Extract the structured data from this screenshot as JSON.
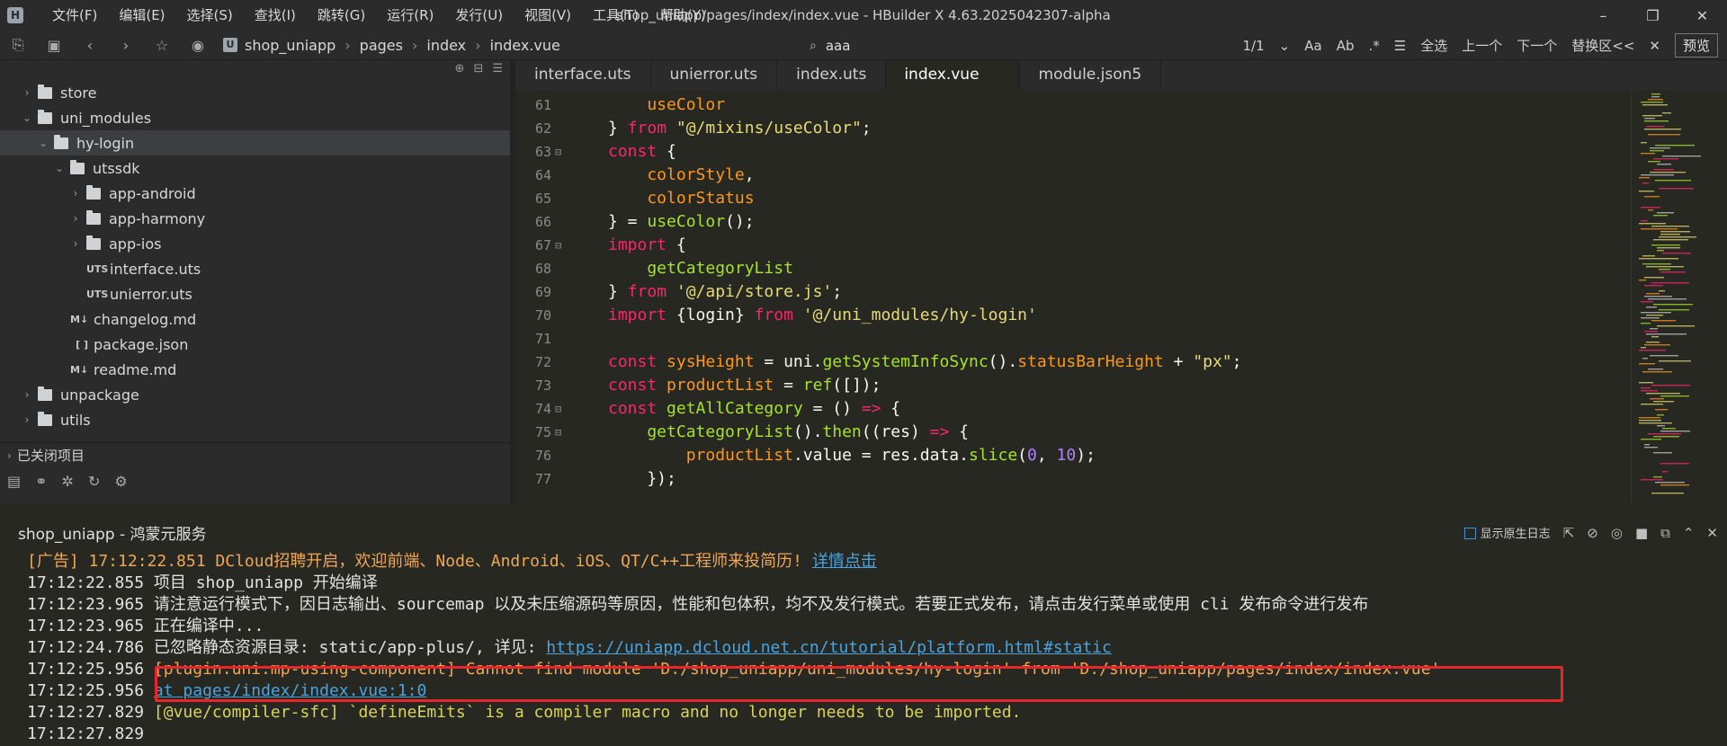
{
  "app": {
    "title": "shop_uniapp/pages/index/index.vue - HBuilder X 4.63.2025042307-alpha",
    "logo_letter": "H"
  },
  "menu": [
    "文件(F)",
    "编辑(E)",
    "选择(S)",
    "查找(I)",
    "跳转(G)",
    "运行(R)",
    "发行(U)",
    "视图(V)",
    "工具(T)",
    "帮助(Y)"
  ],
  "window_controls": {
    "minimize": "–",
    "restore": "❐",
    "close": "✕"
  },
  "toolbar": {
    "breadcrumb_icon": "U",
    "breadcrumb": [
      "shop_uniapp",
      "pages",
      "index",
      "index.vue"
    ],
    "search_value": "aaa",
    "match_count": "1/1",
    "select_all": "全选",
    "prev": "上一个",
    "next": "下一个",
    "replace": "替换区<<",
    "preview": "预览"
  },
  "sidebar": {
    "items": [
      {
        "label": "store",
        "type": "folder",
        "indent": 0,
        "arrow": "›"
      },
      {
        "label": "uni_modules",
        "type": "folder",
        "indent": 0,
        "arrow": "⌄"
      },
      {
        "label": "hy-login",
        "type": "folder",
        "indent": 1,
        "arrow": "⌄",
        "selected": true
      },
      {
        "label": "utssdk",
        "type": "folder",
        "indent": 2,
        "arrow": "⌄"
      },
      {
        "label": "app-android",
        "type": "folder",
        "indent": 3,
        "arrow": "›"
      },
      {
        "label": "app-harmony",
        "type": "folder",
        "indent": 3,
        "arrow": "›"
      },
      {
        "label": "app-ios",
        "type": "folder",
        "indent": 3,
        "arrow": "›"
      },
      {
        "label": "interface.uts",
        "type": "file",
        "tag": "UTS",
        "indent": 3
      },
      {
        "label": "unierror.uts",
        "type": "file",
        "tag": "UTS",
        "indent": 3
      },
      {
        "label": "changelog.md",
        "type": "file",
        "tag": "M↓",
        "indent": 2
      },
      {
        "label": "package.json",
        "type": "file",
        "tag": "[ ]",
        "indent": 2
      },
      {
        "label": "readme.md",
        "type": "file",
        "tag": "M↓",
        "indent": 2
      },
      {
        "label": "unpackage",
        "type": "folder",
        "indent": 0,
        "arrow": "›"
      },
      {
        "label": "utils",
        "type": "folder",
        "indent": 0,
        "arrow": "›"
      }
    ],
    "closed_projects": "已关闭项目"
  },
  "tabs": [
    {
      "label": "interface.uts",
      "active": false
    },
    {
      "label": "unierror.uts",
      "active": false
    },
    {
      "label": "index.uts",
      "active": false
    },
    {
      "label": "index.vue",
      "active": true
    },
    {
      "label": "module.json5",
      "active": false
    }
  ],
  "code": [
    {
      "ln": "61",
      "fold": "",
      "parts": [
        [
          "pm",
          "    useColor"
        ]
      ]
    },
    {
      "ln": "62",
      "fold": "",
      "parts": [
        [
          "pl",
          "} "
        ],
        [
          "kw",
          "from "
        ],
        [
          "st",
          "\"@/mixins/useColor\""
        ],
        [
          "pl",
          ";"
        ]
      ]
    },
    {
      "ln": "63",
      "fold": "⊟",
      "parts": [
        [
          "kw",
          "const "
        ],
        [
          "pl",
          "{"
        ]
      ]
    },
    {
      "ln": "64",
      "fold": "",
      "parts": [
        [
          "pm",
          "    colorStyle"
        ],
        [
          "pl",
          ","
        ]
      ]
    },
    {
      "ln": "65",
      "fold": "",
      "parts": [
        [
          "pm",
          "    colorStatus"
        ]
      ]
    },
    {
      "ln": "66",
      "fold": "",
      "parts": [
        [
          "pl",
          "} = "
        ],
        [
          "fn",
          "useColor"
        ],
        [
          "pl",
          "();"
        ]
      ]
    },
    {
      "ln": "67",
      "fold": "⊟",
      "parts": [
        [
          "kw",
          "import "
        ],
        [
          "pl",
          "{"
        ]
      ]
    },
    {
      "ln": "68",
      "fold": "",
      "parts": [
        [
          "fn",
          "    getCategoryList"
        ]
      ]
    },
    {
      "ln": "69",
      "fold": "",
      "parts": [
        [
          "pl",
          "} "
        ],
        [
          "kw",
          "from "
        ],
        [
          "st",
          "'@/api/store.js'"
        ],
        [
          "pl",
          ";"
        ]
      ]
    },
    {
      "ln": "70",
      "fold": "",
      "parts": [
        [
          "kw",
          "import "
        ],
        [
          "pl",
          "{login} "
        ],
        [
          "kw",
          "from "
        ],
        [
          "st",
          "'@/uni_modules/hy-login'"
        ]
      ]
    },
    {
      "ln": "71",
      "fold": "",
      "parts": [
        [
          "pl",
          ""
        ]
      ]
    },
    {
      "ln": "72",
      "fold": "",
      "parts": [
        [
          "kw",
          "const "
        ],
        [
          "pm",
          "sysHeight "
        ],
        [
          "pl",
          "= uni."
        ],
        [
          "fn",
          "getSystemInfoSync"
        ],
        [
          "pl",
          "()."
        ],
        [
          "pm",
          "statusBarHeight "
        ],
        [
          "pl",
          "+ "
        ],
        [
          "st",
          "\"px\""
        ],
        [
          "pl",
          ";"
        ]
      ]
    },
    {
      "ln": "73",
      "fold": "",
      "parts": [
        [
          "kw",
          "const "
        ],
        [
          "pm",
          "productList "
        ],
        [
          "pl",
          "= "
        ],
        [
          "fn",
          "ref"
        ],
        [
          "pl",
          "([]);"
        ]
      ]
    },
    {
      "ln": "74",
      "fold": "⊟",
      "parts": [
        [
          "kw",
          "const "
        ],
        [
          "fn",
          "getAllCategory "
        ],
        [
          "pl",
          "= () "
        ],
        [
          "kw",
          "=> "
        ],
        [
          "pl",
          "{"
        ]
      ]
    },
    {
      "ln": "75",
      "fold": "⊟",
      "parts": [
        [
          "fn",
          "    getCategoryList"
        ],
        [
          "pl",
          "()."
        ],
        [
          "fn",
          "then"
        ],
        [
          "pl",
          "((res) "
        ],
        [
          "kw",
          "=> "
        ],
        [
          "pl",
          "{"
        ]
      ]
    },
    {
      "ln": "76",
      "fold": "",
      "parts": [
        [
          "pm",
          "        productList"
        ],
        [
          "pl",
          ".value = res.data."
        ],
        [
          "fn",
          "slice"
        ],
        [
          "pl",
          "("
        ],
        [
          "nm",
          "0"
        ],
        [
          "pl",
          ", "
        ],
        [
          "nm",
          "10"
        ],
        [
          "pl",
          ");"
        ]
      ]
    },
    {
      "ln": "77",
      "fold": "",
      "parts": [
        [
          "pl",
          "    });"
        ]
      ]
    }
  ],
  "console": {
    "tab_label": "shop_uniapp - 鸿蒙元服务",
    "native_log_label": "显示原生日志",
    "lines": [
      [
        [
          "orange",
          "[广告] 17:12:22.851 DCloud招聘开启，欢迎前端、Node、Android、iOS、QT/C++工程师来投简历! "
        ],
        [
          "link",
          "详情点击"
        ]
      ],
      [
        [
          "plain",
          "17:12:22.855 项目 shop_uniapp 开始编译"
        ]
      ],
      [
        [
          "plain",
          "17:12:23.965 请注意运行模式下，因日志输出、sourcemap 以及未压缩源码等原因，性能和包体积，均不及发行模式。若要正式发布，请点击发行菜单或使用 cli 发布命令进行发布"
        ]
      ],
      [
        [
          "plain",
          "17:12:23.965 正在编译中..."
        ]
      ],
      [
        [
          "plain",
          "17:12:24.786 已忽略静态资源目录: static/app-plus/, 详见: "
        ],
        [
          "link",
          "https://uniapp.dcloud.net.cn/tutorial/platform.html#static"
        ]
      ],
      [
        [
          "plain",
          "17:12:25.956 "
        ],
        [
          "orange",
          "[plugin:uni:mp-using-component] Cannot find module 'D:/shop_uniapp/uni_modules/hy-login' from 'D:/shop_uniapp/pages/index/index.vue'"
        ]
      ],
      [
        [
          "plain",
          "17:12:25.956 "
        ],
        [
          "link",
          "at pages/index/index.vue:1:0"
        ]
      ],
      [
        [
          "plain",
          "17:12:27.829 "
        ],
        [
          "yellow",
          "[@vue/compiler-sfc] `defineEmits` is a compiler macro and no longer needs to be imported."
        ]
      ],
      [
        [
          "plain",
          "17:12:27.829"
        ]
      ]
    ]
  },
  "icons": {
    "toolbar": [
      "new-file-icon",
      "save-icon",
      "back-icon",
      "forward-icon",
      "star-icon",
      "run-icon"
    ],
    "console_tools": [
      "export-icon",
      "clear-icon",
      "run-icon",
      "stop-icon",
      "float-icon",
      "collapse-icon",
      "close-icon"
    ]
  }
}
